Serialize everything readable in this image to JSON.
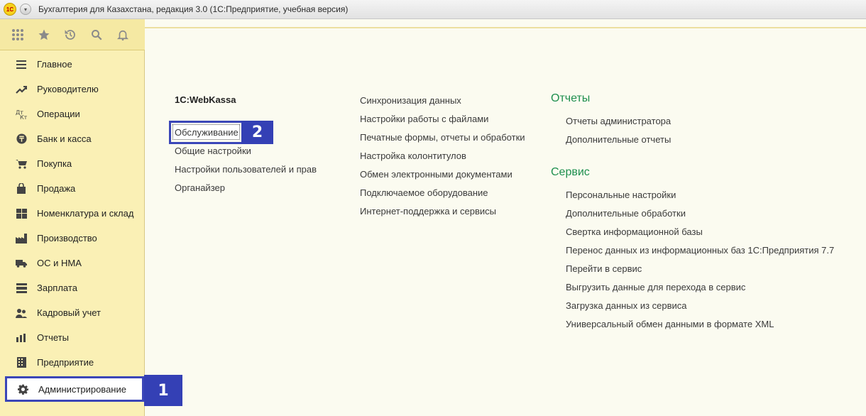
{
  "window": {
    "logo_text": "1С",
    "title": "Бухгалтерия для Казахстана, редакция 3.0  (1С:Предприятие, учебная версия)"
  },
  "toolbar": {
    "icons": [
      "apps-grid-icon",
      "star-icon",
      "history-icon",
      "search-icon",
      "bell-icon"
    ]
  },
  "sidebar": {
    "items": [
      {
        "label": "Главное",
        "icon": "menu-lines-icon"
      },
      {
        "label": "Руководителю",
        "icon": "trend-chart-icon"
      },
      {
        "label": "Операции",
        "icon": "operations-dt-kt-icon"
      },
      {
        "label": "Банк и касса",
        "icon": "tenge-coin-icon"
      },
      {
        "label": "Покупка",
        "icon": "cart-icon"
      },
      {
        "label": "Продажа",
        "icon": "shopping-bag-icon"
      },
      {
        "label": "Номенклатура и склад",
        "icon": "warehouse-grid-icon"
      },
      {
        "label": "Производство",
        "icon": "factory-icon"
      },
      {
        "label": "ОС и НМА",
        "icon": "truck-icon"
      },
      {
        "label": "Зарплата",
        "icon": "salary-icon"
      },
      {
        "label": "Кадровый учет",
        "icon": "people-icon"
      },
      {
        "label": "Отчеты",
        "icon": "bar-chart-icon"
      },
      {
        "label": "Предприятие",
        "icon": "building-icon"
      },
      {
        "label": "Администрирование",
        "icon": "gear-icon"
      }
    ],
    "selected_index": 13
  },
  "annotations": {
    "badge_1": "1",
    "badge_2": "2"
  },
  "main": {
    "col1": {
      "heading": "1С:WebKassa",
      "links": [
        "Обслуживание",
        "Общие настройки",
        "Настройки пользователей и прав",
        "Органайзер"
      ]
    },
    "col2": {
      "links": [
        "Синхронизация данных",
        "Настройки работы с файлами",
        "Печатные формы, отчеты и обработки",
        "Настройка колонтитулов",
        "Обмен электронными документами",
        "Подключаемое оборудование",
        "Интернет-поддержка и сервисы"
      ]
    },
    "col3": {
      "reports_heading": "Отчеты",
      "reports_links": [
        "Отчеты администратора",
        "Дополнительные отчеты"
      ],
      "service_heading": "Сервис",
      "service_links": [
        "Персональные настройки",
        "Дополнительные обработки",
        "Свертка информационной базы",
        "Перенос данных из информационных баз 1С:Предприятия 7.7",
        "Перейти в сервис",
        "Выгрузить данные для перехода в сервис",
        "Загрузка данных из сервиса",
        "Универсальный обмен данными в формате XML"
      ]
    }
  },
  "colors": {
    "sidebar_bg": "#faf0b5",
    "main_bg": "#fbfbf0",
    "group_heading": "#1e8f4e",
    "highlight": "#3440b5"
  }
}
